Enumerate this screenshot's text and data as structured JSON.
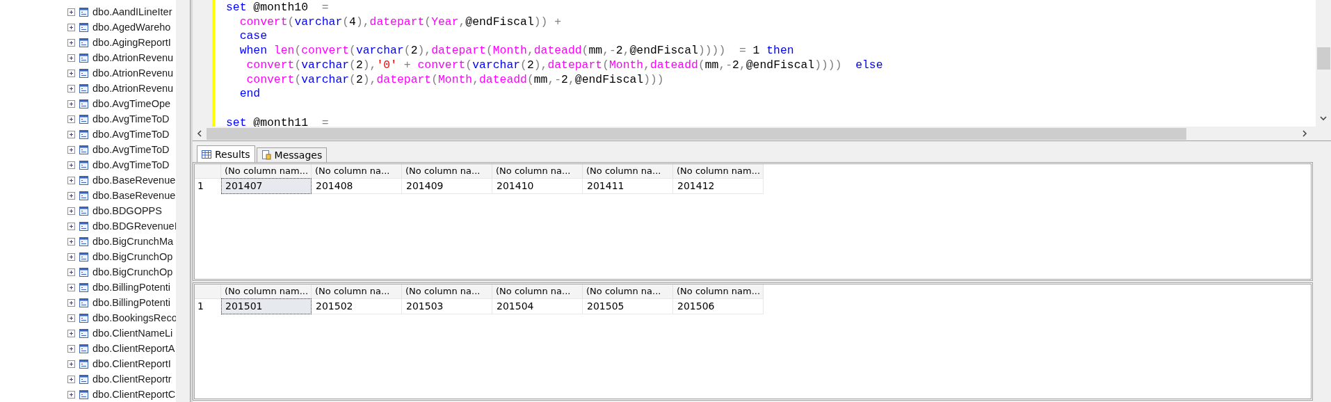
{
  "object_tree": {
    "items": [
      {
        "label": "dbo.AandILineIter",
        "expanded": false
      },
      {
        "label": "dbo.AgedWareho",
        "expanded": false
      },
      {
        "label": "dbo.AgingReportI",
        "expanded": false
      },
      {
        "label": "dbo.AtrionRevenu",
        "expanded": false
      },
      {
        "label": "dbo.AtrionRevenu",
        "expanded": false
      },
      {
        "label": "dbo.AtrionRevenu",
        "expanded": false
      },
      {
        "label": "dbo.AvgTimeOpe",
        "expanded": false
      },
      {
        "label": "dbo.AvgTimeToD",
        "expanded": false
      },
      {
        "label": "dbo.AvgTimeToD",
        "expanded": false
      },
      {
        "label": "dbo.AvgTimeToD",
        "expanded": false
      },
      {
        "label": "dbo.AvgTimeToD",
        "expanded": false
      },
      {
        "label": "dbo.BaseRevenue",
        "expanded": false
      },
      {
        "label": "dbo.BaseRevenue",
        "expanded": false
      },
      {
        "label": "dbo.BDGOPPS",
        "expanded": false
      },
      {
        "label": "dbo.BDGRevenueI",
        "expanded": false
      },
      {
        "label": "dbo.BigCrunchMa",
        "expanded": false
      },
      {
        "label": "dbo.BigCrunchOp",
        "expanded": false
      },
      {
        "label": "dbo.BigCrunchOp",
        "expanded": false
      },
      {
        "label": "dbo.BillingPotenti",
        "expanded": false
      },
      {
        "label": "dbo.BillingPotenti",
        "expanded": false
      },
      {
        "label": "dbo.BookingsReco",
        "expanded": false
      },
      {
        "label": "dbo.ClientNameLi",
        "expanded": false
      },
      {
        "label": "dbo.ClientReportA",
        "expanded": false
      },
      {
        "label": "dbo.ClientReportI",
        "expanded": false
      },
      {
        "label": "dbo.ClientReportr",
        "expanded": false
      },
      {
        "label": "dbo.ClientReportC",
        "expanded": false
      }
    ]
  },
  "editor": {
    "lines": [
      {
        "blank_before": false,
        "tokens": [
          {
            "t": "set",
            "kind": "kw"
          },
          {
            "t": " @month10  ",
            "kind": "id"
          },
          {
            "t": "=",
            "kind": "op"
          }
        ]
      },
      {
        "blank_before": false,
        "tokens": [
          {
            "t": "  convert",
            "kind": "fn"
          },
          {
            "t": "(",
            "kind": "op"
          },
          {
            "t": "varchar",
            "kind": "kw"
          },
          {
            "t": "(",
            "kind": "op"
          },
          {
            "t": "4",
            "kind": "id"
          },
          {
            "t": "),",
            "kind": "op"
          },
          {
            "t": "datepart",
            "kind": "fn"
          },
          {
            "t": "(",
            "kind": "op"
          },
          {
            "t": "Year",
            "kind": "fn"
          },
          {
            "t": ",",
            "kind": "op"
          },
          {
            "t": "@endFiscal",
            "kind": "id"
          },
          {
            "t": "))",
            "kind": "op"
          },
          {
            "t": " +",
            "kind": "op"
          }
        ]
      },
      {
        "blank_before": false,
        "tokens": [
          {
            "t": "  case",
            "kind": "kw"
          }
        ]
      },
      {
        "blank_before": false,
        "tokens": [
          {
            "t": "  when",
            "kind": "kw"
          },
          {
            "t": " len",
            "kind": "fn"
          },
          {
            "t": "(",
            "kind": "op"
          },
          {
            "t": "convert",
            "kind": "fn"
          },
          {
            "t": "(",
            "kind": "op"
          },
          {
            "t": "varchar",
            "kind": "kw"
          },
          {
            "t": "(",
            "kind": "op"
          },
          {
            "t": "2",
            "kind": "id"
          },
          {
            "t": "),",
            "kind": "op"
          },
          {
            "t": "datepart",
            "kind": "fn"
          },
          {
            "t": "(",
            "kind": "op"
          },
          {
            "t": "Month",
            "kind": "fn"
          },
          {
            "t": ",",
            "kind": "op"
          },
          {
            "t": "dateadd",
            "kind": "fn"
          },
          {
            "t": "(",
            "kind": "op"
          },
          {
            "t": "mm",
            "kind": "id"
          },
          {
            "t": ",-",
            "kind": "op"
          },
          {
            "t": "2",
            "kind": "id"
          },
          {
            "t": ",",
            "kind": "op"
          },
          {
            "t": "@endFiscal",
            "kind": "id"
          },
          {
            "t": "))))",
            "kind": "op"
          },
          {
            "t": "  =",
            "kind": "op"
          },
          {
            "t": " 1 ",
            "kind": "id"
          },
          {
            "t": "then",
            "kind": "kw"
          }
        ]
      },
      {
        "blank_before": false,
        "tokens": [
          {
            "t": "   convert",
            "kind": "fn"
          },
          {
            "t": "(",
            "kind": "op"
          },
          {
            "t": "varchar",
            "kind": "kw"
          },
          {
            "t": "(",
            "kind": "op"
          },
          {
            "t": "2",
            "kind": "id"
          },
          {
            "t": "),",
            "kind": "op"
          },
          {
            "t": "'0'",
            "kind": "str"
          },
          {
            "t": " +",
            "kind": "op"
          },
          {
            "t": " convert",
            "kind": "fn"
          },
          {
            "t": "(",
            "kind": "op"
          },
          {
            "t": "varchar",
            "kind": "kw"
          },
          {
            "t": "(",
            "kind": "op"
          },
          {
            "t": "2",
            "kind": "id"
          },
          {
            "t": "),",
            "kind": "op"
          },
          {
            "t": "datepart",
            "kind": "fn"
          },
          {
            "t": "(",
            "kind": "op"
          },
          {
            "t": "Month",
            "kind": "fn"
          },
          {
            "t": ",",
            "kind": "op"
          },
          {
            "t": "dateadd",
            "kind": "fn"
          },
          {
            "t": "(",
            "kind": "op"
          },
          {
            "t": "mm",
            "kind": "id"
          },
          {
            "t": ",-",
            "kind": "op"
          },
          {
            "t": "2",
            "kind": "id"
          },
          {
            "t": ",",
            "kind": "op"
          },
          {
            "t": "@endFiscal",
            "kind": "id"
          },
          {
            "t": "))))",
            "kind": "op"
          },
          {
            "t": "  else",
            "kind": "kw"
          }
        ]
      },
      {
        "blank_before": false,
        "tokens": [
          {
            "t": "   convert",
            "kind": "fn"
          },
          {
            "t": "(",
            "kind": "op"
          },
          {
            "t": "varchar",
            "kind": "kw"
          },
          {
            "t": "(",
            "kind": "op"
          },
          {
            "t": "2",
            "kind": "id"
          },
          {
            "t": "),",
            "kind": "op"
          },
          {
            "t": "datepart",
            "kind": "fn"
          },
          {
            "t": "(",
            "kind": "op"
          },
          {
            "t": "Month",
            "kind": "fn"
          },
          {
            "t": ",",
            "kind": "op"
          },
          {
            "t": "dateadd",
            "kind": "fn"
          },
          {
            "t": "(",
            "kind": "op"
          },
          {
            "t": "mm",
            "kind": "id"
          },
          {
            "t": ",-",
            "kind": "op"
          },
          {
            "t": "2",
            "kind": "id"
          },
          {
            "t": ",",
            "kind": "op"
          },
          {
            "t": "@endFiscal",
            "kind": "id"
          },
          {
            "t": ")))",
            "kind": "op"
          }
        ]
      },
      {
        "blank_before": false,
        "tokens": [
          {
            "t": "  end",
            "kind": "kw"
          }
        ]
      },
      {
        "blank_before": true,
        "tokens": [
          {
            "t": "set",
            "kind": "kw"
          },
          {
            "t": " @month11  ",
            "kind": "id"
          },
          {
            "t": "=",
            "kind": "op"
          }
        ]
      }
    ]
  },
  "result_tabs": [
    {
      "label": "Results",
      "selected": true
    },
    {
      "label": "Messages",
      "selected": false
    }
  ],
  "result_grids": [
    {
      "columns": [
        "(No column nam...",
        "(No column na...",
        "(No column na...",
        "(No column na...",
        "(No column na...",
        "(No column nam..."
      ],
      "rows": [
        {
          "number": "1",
          "cells": [
            {
              "text": "201407",
              "focused": true
            },
            {
              "text": "201408",
              "focused": false
            },
            {
              "text": "201409",
              "focused": false
            },
            {
              "text": "201410",
              "focused": false
            },
            {
              "text": "201411",
              "focused": false
            },
            {
              "text": "201412",
              "focused": false
            }
          ]
        }
      ]
    },
    {
      "columns": [
        "(No column nam...",
        "(No column na...",
        "(No column na...",
        "(No column na...",
        "(No column na...",
        "(No column nam..."
      ],
      "rows": [
        {
          "number": "1",
          "cells": [
            {
              "text": "201501",
              "focused": true
            },
            {
              "text": "201502",
              "focused": false
            },
            {
              "text": "201503",
              "focused": false
            },
            {
              "text": "201504",
              "focused": false
            },
            {
              "text": "201505",
              "focused": false
            },
            {
              "text": "201506",
              "focused": false
            }
          ]
        }
      ]
    }
  ]
}
